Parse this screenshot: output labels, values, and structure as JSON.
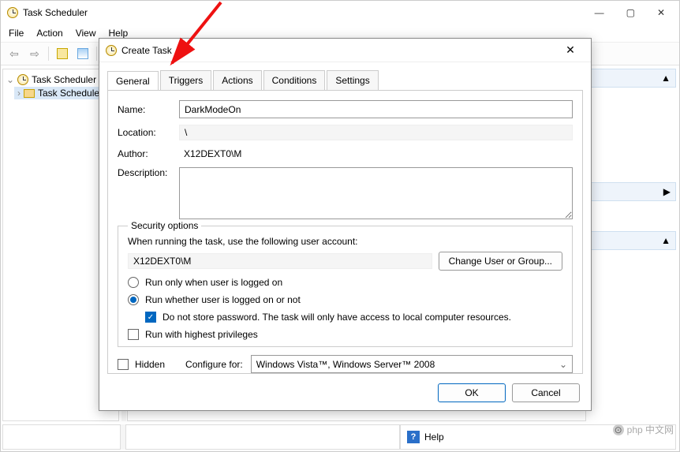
{
  "annotation": {
    "arrow_points_to": "tab-triggers"
  },
  "main": {
    "title": "Task Scheduler",
    "menu": [
      "File",
      "Action",
      "View",
      "Help"
    ],
    "tree": {
      "root": "Task Scheduler (L",
      "child": "Task Schedule"
    },
    "status_help": "Help",
    "side_arrows": {
      "up1": "▲",
      "right": "▶",
      "up2": "▲"
    }
  },
  "dialog": {
    "title": "Create Task",
    "tabs": [
      "General",
      "Triggers",
      "Actions",
      "Conditions",
      "Settings"
    ],
    "active_tab": "General",
    "fields": {
      "name_label": "Name:",
      "name_value": "DarkModeOn",
      "location_label": "Location:",
      "location_value": "\\",
      "author_label": "Author:",
      "author_value": "X12DEXT0\\M",
      "description_label": "Description:"
    },
    "security": {
      "legend": "Security options",
      "when_running": "When running the task, use the following user account:",
      "account": "X12DEXT0\\M",
      "change_user": "Change User or Group...",
      "run_logged_on": "Run only when user is logged on",
      "run_whether": "Run whether user is logged on or not",
      "dont_store": "Do not store password.  The task will only have access to local computer resources.",
      "highest": "Run with highest privileges"
    },
    "bottom": {
      "hidden": "Hidden",
      "configure_label": "Configure for:",
      "configure_value": "Windows Vista™, Windows Server™ 2008"
    },
    "buttons": {
      "ok": "OK",
      "cancel": "Cancel"
    }
  },
  "watermark": "php 中文网"
}
